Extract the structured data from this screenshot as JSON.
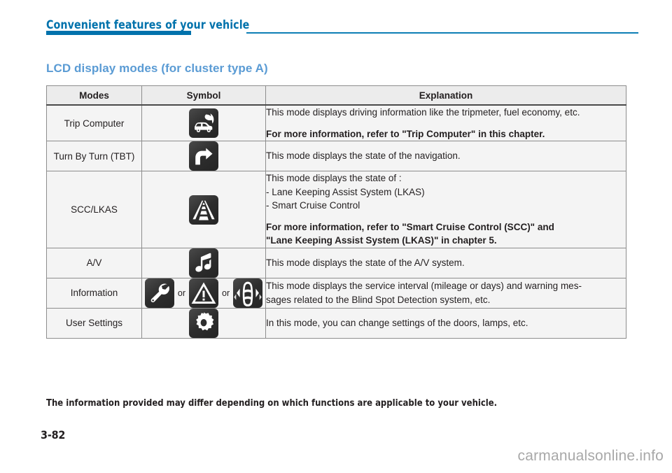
{
  "header": {
    "title": "Convenient features of your vehicle",
    "accent_color": "#0072ac"
  },
  "section": {
    "title": "LCD display modes (for cluster type A)",
    "color": "#5a9bd4"
  },
  "table": {
    "columns": [
      "Modes",
      "Symbol",
      "Explanation"
    ],
    "rows": [
      {
        "mode": "Trip Computer",
        "icons": [
          "car-leaf-icon"
        ],
        "explanation_lines": [
          {
            "text": "This mode displays driving information like the tripmeter, fuel economy, etc.",
            "bold": false
          },
          {
            "text": "",
            "bold": false
          },
          {
            "text": "For more information, refer to \"Trip Computer\" in this chapter.",
            "bold": true
          }
        ]
      },
      {
        "mode": "Turn By Turn (TBT)",
        "icons": [
          "turn-right-arrow-icon"
        ],
        "explanation_lines": [
          {
            "text": "This mode displays the state of the navigation.",
            "bold": false
          }
        ]
      },
      {
        "mode": "SCC/LKAS",
        "icons": [
          "lane-road-icon"
        ],
        "explanation_lines": [
          {
            "text": "This mode displays the state of :",
            "bold": false
          },
          {
            "text": "- Lane Keeping Assist System (LKAS)",
            "bold": false
          },
          {
            "text": "- Smart Cruise Control",
            "bold": false
          },
          {
            "text": "",
            "bold": false
          },
          {
            "text": "For more information, refer to \"Smart Cruise Control (SCC)\" and",
            "bold": true
          },
          {
            "text": "\"Lane Keeping Assist System (LKAS)\" in chapter 5.",
            "bold": true
          }
        ]
      },
      {
        "mode": "A/V",
        "icons": [
          "music-note-icon"
        ],
        "explanation_lines": [
          {
            "text": "This mode displays the state of the A/V system.",
            "bold": false
          }
        ]
      },
      {
        "mode": "Information",
        "icons": [
          "wrench-icon",
          "warning-triangle-icon",
          "blind-spot-car-icon"
        ],
        "icon_separator": "or",
        "explanation_lines": [
          {
            "text": "This mode displays the service interval (mileage or days) and warning mes-",
            "bold": false
          },
          {
            "text": "sages related to the Blind Spot Detection system, etc.",
            "bold": false
          }
        ]
      },
      {
        "mode": "User Settings",
        "icons": [
          "gear-icon"
        ],
        "explanation_lines": [
          {
            "text": "In this mode, you can change settings of the doors, lamps, etc.",
            "bold": false
          }
        ]
      }
    ]
  },
  "footnote": "The information provided may differ depending on which functions are applicable to your vehicle.",
  "footer": {
    "page_number": "3-82",
    "watermark": "carmanualsonline.info"
  }
}
